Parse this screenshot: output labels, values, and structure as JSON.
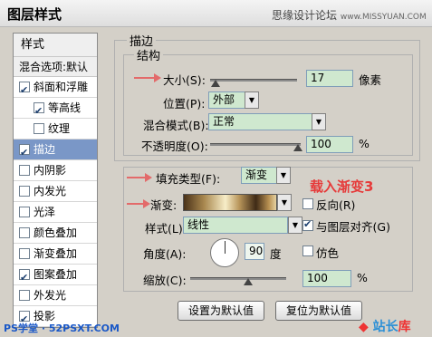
{
  "window": {
    "title": "图层样式",
    "watermark": "思缘设计论坛",
    "watermark_url": "www.MISSYUAN.COM"
  },
  "sidebar": {
    "header": "样式",
    "blend_options": "混合选项:默认",
    "items": [
      {
        "label": "斜面和浮雕",
        "checked": true
      },
      {
        "label": "等高线",
        "checked": true
      },
      {
        "label": "纹理",
        "checked": false
      },
      {
        "label": "描边",
        "checked": true
      },
      {
        "label": "内阴影",
        "checked": false
      },
      {
        "label": "内发光",
        "checked": false
      },
      {
        "label": "光泽",
        "checked": false
      },
      {
        "label": "颜色叠加",
        "checked": false
      },
      {
        "label": "渐变叠加",
        "checked": false
      },
      {
        "label": "图案叠加",
        "checked": true
      },
      {
        "label": "外发光",
        "checked": false
      },
      {
        "label": "投影",
        "checked": true
      }
    ],
    "corner_text": "PS学堂 · 52PSXT.COM"
  },
  "stroke": {
    "section": "描边",
    "structure": {
      "legend": "结构",
      "size_label": "大小(S):",
      "size_value": "17",
      "size_unit": "像素",
      "position_label": "位置(P):",
      "position_value": "外部",
      "blend_label": "混合模式(B):",
      "blend_value": "正常",
      "opacity_label": "不透明度(O):",
      "opacity_value": "100",
      "opacity_unit": "%"
    },
    "fill": {
      "type_label": "填充类型(F):",
      "type_value": "渐变",
      "annotation": "载入渐变3",
      "gradient_label": "渐变:",
      "reverse_label": "反向(R)",
      "reverse_checked": false,
      "style_label": "样式(L):",
      "style_value": "线性",
      "align_label": "与图层对齐(G)",
      "align_checked": true,
      "angle_label": "角度(A):",
      "angle_value": "90",
      "angle_unit": "度",
      "dither_label": "仿色",
      "dither_checked": false,
      "scale_label": "缩放(C):",
      "scale_value": "100",
      "scale_unit": "%"
    }
  },
  "buttons": {
    "set_default": "设置为默认值",
    "reset_default": "复位为默认值"
  },
  "logo": {
    "text": "站长",
    "accent": "库"
  },
  "colors": {
    "selection": "#7a97c7",
    "field_bg": "#cfe8cf",
    "annotation": "#e63a3a",
    "arrow": "#e36a6a"
  }
}
